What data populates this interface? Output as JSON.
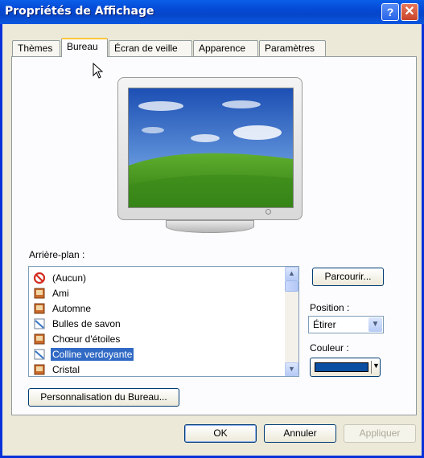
{
  "window": {
    "title": "Propriétés de Affichage",
    "help_glyph": "?",
    "close_glyph": "✕"
  },
  "tabs": [
    {
      "label": "Thèmes"
    },
    {
      "label": "Bureau"
    },
    {
      "label": "Écran de veille"
    },
    {
      "label": "Apparence"
    },
    {
      "label": "Paramètres"
    }
  ],
  "active_tab": "Bureau",
  "background_label": "Arrière-plan :",
  "background_list": [
    {
      "label": "(Aucun)",
      "icon": "none-icon"
    },
    {
      "label": "Ami",
      "icon": "image-file-icon"
    },
    {
      "label": "Automne",
      "icon": "image-file-icon"
    },
    {
      "label": "Bulles de savon",
      "icon": "bitmap-file-icon"
    },
    {
      "label": "Chœur d'étoiles",
      "icon": "image-file-icon"
    },
    {
      "label": "Colline verdoyante",
      "icon": "bitmap-file-icon",
      "selected": true
    },
    {
      "label": "Cristal",
      "icon": "image-file-icon"
    }
  ],
  "browse_button": "Parcourir...",
  "position_label": "Position :",
  "position_value": "Étirer",
  "color_label": "Couleur :",
  "color_value": "#0a4ea2",
  "customize_button": "Personnalisation du Bureau...",
  "footer": {
    "ok": "OK",
    "cancel": "Annuler",
    "apply": "Appliquer"
  }
}
